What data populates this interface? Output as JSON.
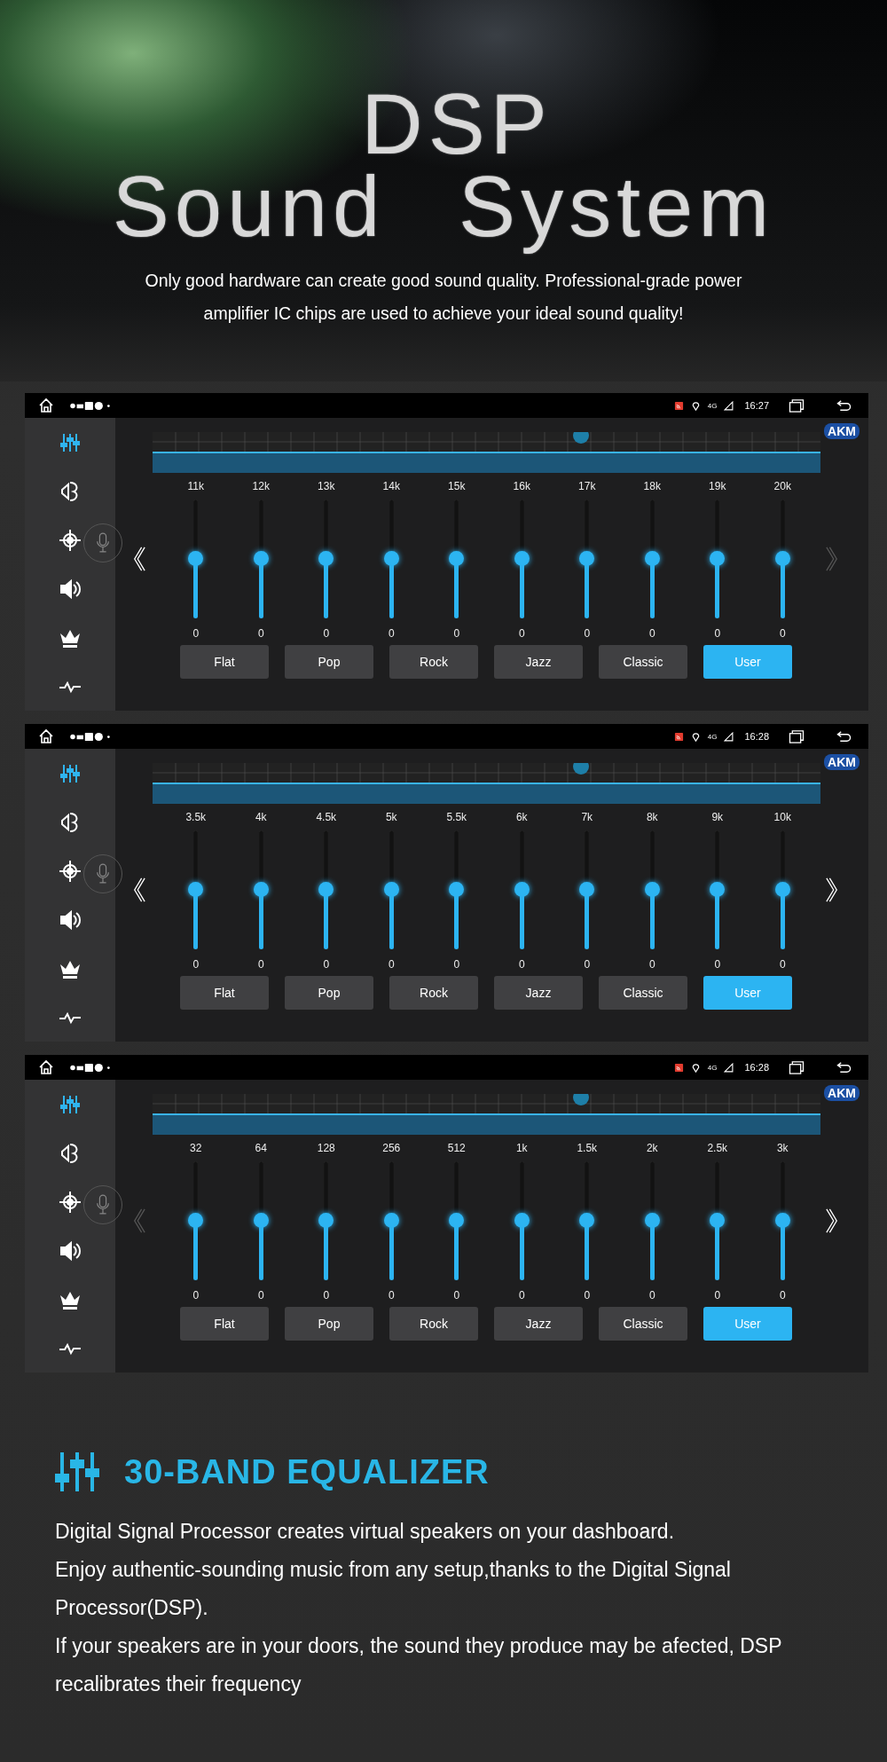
{
  "hero": {
    "title_line_1": "DSP",
    "title_line_2": "Sound System",
    "subtitle": "Only good hardware can create good sound quality. Professional-grade power amplifier IC chips are used to achieve your ideal sound quality!"
  },
  "panels": [
    {
      "time": "16:27",
      "network": "4G",
      "brand": "AKM",
      "prev_enabled": true,
      "next_enabled": false,
      "sidebar": [
        {
          "kind": "equalizer",
          "selected": true
        },
        {
          "kind": "speaker",
          "selected": false
        },
        {
          "kind": "position",
          "selected": false
        },
        {
          "kind": "volume",
          "selected": false
        },
        {
          "kind": "crown",
          "selected": false
        },
        {
          "kind": "pulse",
          "selected": false
        }
      ],
      "bands": [
        {
          "label": "11k",
          "value": "0",
          "level": 0.5
        },
        {
          "label": "12k",
          "value": "0",
          "level": 0.5
        },
        {
          "label": "13k",
          "value": "0",
          "level": 0.5
        },
        {
          "label": "14k",
          "value": "0",
          "level": 0.5
        },
        {
          "label": "15k",
          "value": "0",
          "level": 0.5
        },
        {
          "label": "16k",
          "value": "0",
          "level": 0.5
        },
        {
          "label": "17k",
          "value": "0",
          "level": 0.5
        },
        {
          "label": "18k",
          "value": "0",
          "level": 0.5
        },
        {
          "label": "19k",
          "value": "0",
          "level": 0.5
        },
        {
          "label": "20k",
          "value": "0",
          "level": 0.5
        }
      ],
      "presets": [
        {
          "label": "Flat",
          "selected": false
        },
        {
          "label": "Pop",
          "selected": false
        },
        {
          "label": "Rock",
          "selected": false
        },
        {
          "label": "Jazz",
          "selected": false
        },
        {
          "label": "Classic",
          "selected": false
        },
        {
          "label": "User",
          "selected": true
        }
      ]
    },
    {
      "time": "16:28",
      "network": "4G",
      "brand": "AKM",
      "prev_enabled": true,
      "next_enabled": true,
      "sidebar": [
        {
          "kind": "equalizer",
          "selected": true
        },
        {
          "kind": "speaker",
          "selected": false
        },
        {
          "kind": "position",
          "selected": false
        },
        {
          "kind": "volume",
          "selected": false
        },
        {
          "kind": "crown",
          "selected": false
        },
        {
          "kind": "pulse",
          "selected": false
        }
      ],
      "bands": [
        {
          "label": "3.5k",
          "value": "0",
          "level": 0.5
        },
        {
          "label": "4k",
          "value": "0",
          "level": 0.5
        },
        {
          "label": "4.5k",
          "value": "0",
          "level": 0.5
        },
        {
          "label": "5k",
          "value": "0",
          "level": 0.5
        },
        {
          "label": "5.5k",
          "value": "0",
          "level": 0.5
        },
        {
          "label": "6k",
          "value": "0",
          "level": 0.5
        },
        {
          "label": "7k",
          "value": "0",
          "level": 0.5
        },
        {
          "label": "8k",
          "value": "0",
          "level": 0.5
        },
        {
          "label": "9k",
          "value": "0",
          "level": 0.5
        },
        {
          "label": "10k",
          "value": "0",
          "level": 0.5
        }
      ],
      "presets": [
        {
          "label": "Flat",
          "selected": false
        },
        {
          "label": "Pop",
          "selected": false
        },
        {
          "label": "Rock",
          "selected": false
        },
        {
          "label": "Jazz",
          "selected": false
        },
        {
          "label": "Classic",
          "selected": false
        },
        {
          "label": "User",
          "selected": true
        }
      ]
    },
    {
      "time": "16:28",
      "network": "4G",
      "brand": "AKM",
      "prev_enabled": false,
      "next_enabled": true,
      "sidebar": [
        {
          "kind": "equalizer",
          "selected": true
        },
        {
          "kind": "speaker",
          "selected": false
        },
        {
          "kind": "position",
          "selected": false
        },
        {
          "kind": "volume",
          "selected": false
        },
        {
          "kind": "crown",
          "selected": false
        },
        {
          "kind": "pulse",
          "selected": false
        }
      ],
      "bands": [
        {
          "label": "32",
          "value": "0",
          "level": 0.5
        },
        {
          "label": "64",
          "value": "0",
          "level": 0.5
        },
        {
          "label": "128",
          "value": "0",
          "level": 0.5
        },
        {
          "label": "256",
          "value": "0",
          "level": 0.5
        },
        {
          "label": "512",
          "value": "0",
          "level": 0.5
        },
        {
          "label": "1k",
          "value": "0",
          "level": 0.5
        },
        {
          "label": "1.5k",
          "value": "0",
          "level": 0.5
        },
        {
          "label": "2k",
          "value": "0",
          "level": 0.5
        },
        {
          "label": "2.5k",
          "value": "0",
          "level": 0.5
        },
        {
          "label": "3k",
          "value": "0",
          "level": 0.5
        }
      ],
      "presets": [
        {
          "label": "Flat",
          "selected": false
        },
        {
          "label": "Pop",
          "selected": false
        },
        {
          "label": "Rock",
          "selected": false
        },
        {
          "label": "Jazz",
          "selected": false
        },
        {
          "label": "Classic",
          "selected": false
        },
        {
          "label": "User",
          "selected": true
        }
      ]
    }
  ],
  "feature": {
    "heading": "30-BAND EQUALIZER",
    "paragraphs": [
      "Digital Signal Processor creates virtual speakers on your dashboard.",
      "Enjoy authentic-sounding music from any setup,thanks to the Digital Signal Processor(DSP).",
      "If your speakers are in your doors, the sound they produce may be afected, DSP recalibrates their frequency"
    ]
  }
}
